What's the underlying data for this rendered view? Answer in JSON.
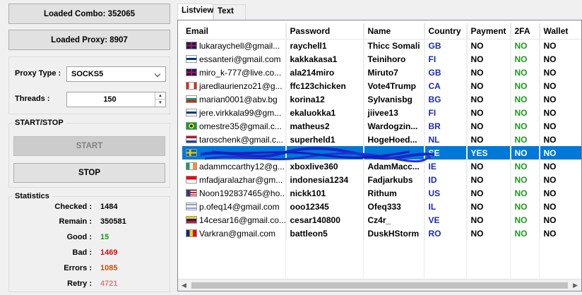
{
  "left": {
    "loaded_combo": "Loaded Combo: 352065",
    "loaded_proxy": "Loaded Proxy: 8907",
    "proxy_type_label": "Proxy Type :",
    "proxy_type_value": "SOCKS5",
    "threads_label": "Threads :",
    "threads_value": "150",
    "start_stop_title": "START/STOP",
    "start_label": "START",
    "stop_label": "STOP",
    "stats_title": "Statistics",
    "stats": [
      {
        "label": "Checked :",
        "value": "1484",
        "color": "#000000"
      },
      {
        "label": "Remain :",
        "value": "350581",
        "color": "#000000"
      },
      {
        "label": "Good :",
        "value": "15",
        "color": "#1a9a1a"
      },
      {
        "label": "Bad :",
        "value": "1469",
        "color": "#d01010"
      },
      {
        "label": "Errors :",
        "value": "1085",
        "color": "#c05010"
      },
      {
        "label": "Retry :",
        "value": "4721",
        "color": "#e08080"
      }
    ]
  },
  "tabs": [
    "Listview",
    "Text"
  ],
  "table": {
    "headers": [
      "Email",
      "Password",
      "Name",
      "Country",
      "Payment",
      "2FA",
      "Wallet"
    ],
    "rows": [
      {
        "flag": "gb",
        "email": "lukaraychell@gmail...",
        "password": "raychell1",
        "name": "Thicc Somali",
        "country": "GB",
        "payment": "NO",
        "fa": "NO",
        "wallet": "NO"
      },
      {
        "flag": "fi",
        "email": "essanteri@gmail.com",
        "password": "kakkakasa1",
        "name": "Teinihoro",
        "country": "FI",
        "payment": "NO",
        "fa": "NO",
        "wallet": "NO"
      },
      {
        "flag": "gb",
        "email": "miro_k-777@live.co...",
        "password": "ala214miro",
        "name": "Miruto7",
        "country": "GB",
        "payment": "NO",
        "fa": "NO",
        "wallet": "NO"
      },
      {
        "flag": "ca",
        "email": "jaredlaurienzo21@g...",
        "password": "ffc123chicken",
        "name": "Vote4Trump",
        "country": "CA",
        "payment": "NO",
        "fa": "NO",
        "wallet": "NO"
      },
      {
        "flag": "bg",
        "email": "marian0001@abv.bg",
        "password": "korina12",
        "name": "Sylvanisbg",
        "country": "BG",
        "payment": "NO",
        "fa": "NO",
        "wallet": "NO"
      },
      {
        "flag": "fi",
        "email": "jere.virkkala99@gm...",
        "password": "ekaluokka1",
        "name": "jiivee13",
        "country": "FI",
        "payment": "NO",
        "fa": "NO",
        "wallet": "NO"
      },
      {
        "flag": "br",
        "email": "omestre35@gmail.c...",
        "password": "matheus2",
        "name": "Wardogzin...",
        "country": "BR",
        "payment": "NO",
        "fa": "NO",
        "wallet": "NO"
      },
      {
        "flag": "nl",
        "email": "taroschenk@gmail.c...",
        "password": "superheld1",
        "name": "HogeHoed...",
        "country": "NL",
        "payment": "NO",
        "fa": "NO",
        "wallet": "NO"
      },
      {
        "flag": "se",
        "email": "",
        "password": "",
        "name": "",
        "country": "SE",
        "payment": "YES",
        "fa": "NO",
        "wallet": "NO",
        "selected": true
      },
      {
        "flag": "ie",
        "email": "adammccarthy12@g...",
        "password": "xboxlive360",
        "name": "AdamMacc...",
        "country": "IE",
        "payment": "NO",
        "fa": "NO",
        "wallet": "NO"
      },
      {
        "flag": "id",
        "email": "mfadjaralazhar@gm...",
        "password": "indonesia1234",
        "name": "Fadjarkubs",
        "country": "ID",
        "payment": "NO",
        "fa": "NO",
        "wallet": "NO"
      },
      {
        "flag": "us",
        "email": "Noon192837465@ho...",
        "password": "nickk101",
        "name": "Rithum",
        "country": "US",
        "payment": "NO",
        "fa": "NO",
        "wallet": "NO"
      },
      {
        "flag": "il",
        "email": "p.ofeq14@gmail.com",
        "password": "ooo12345",
        "name": "Ofeq333",
        "country": "IL",
        "payment": "NO",
        "fa": "NO",
        "wallet": "NO"
      },
      {
        "flag": "ve",
        "email": "14cesar16@gmail.co...",
        "password": "cesar140800",
        "name": "Cz4r_",
        "country": "VE",
        "payment": "NO",
        "fa": "NO",
        "wallet": "NO"
      },
      {
        "flag": "ro",
        "email": "Varkran@gmail.com",
        "password": "battleon5",
        "name": "DuskHStorm",
        "country": "RO",
        "payment": "NO",
        "fa": "NO",
        "wallet": "NO"
      }
    ]
  }
}
